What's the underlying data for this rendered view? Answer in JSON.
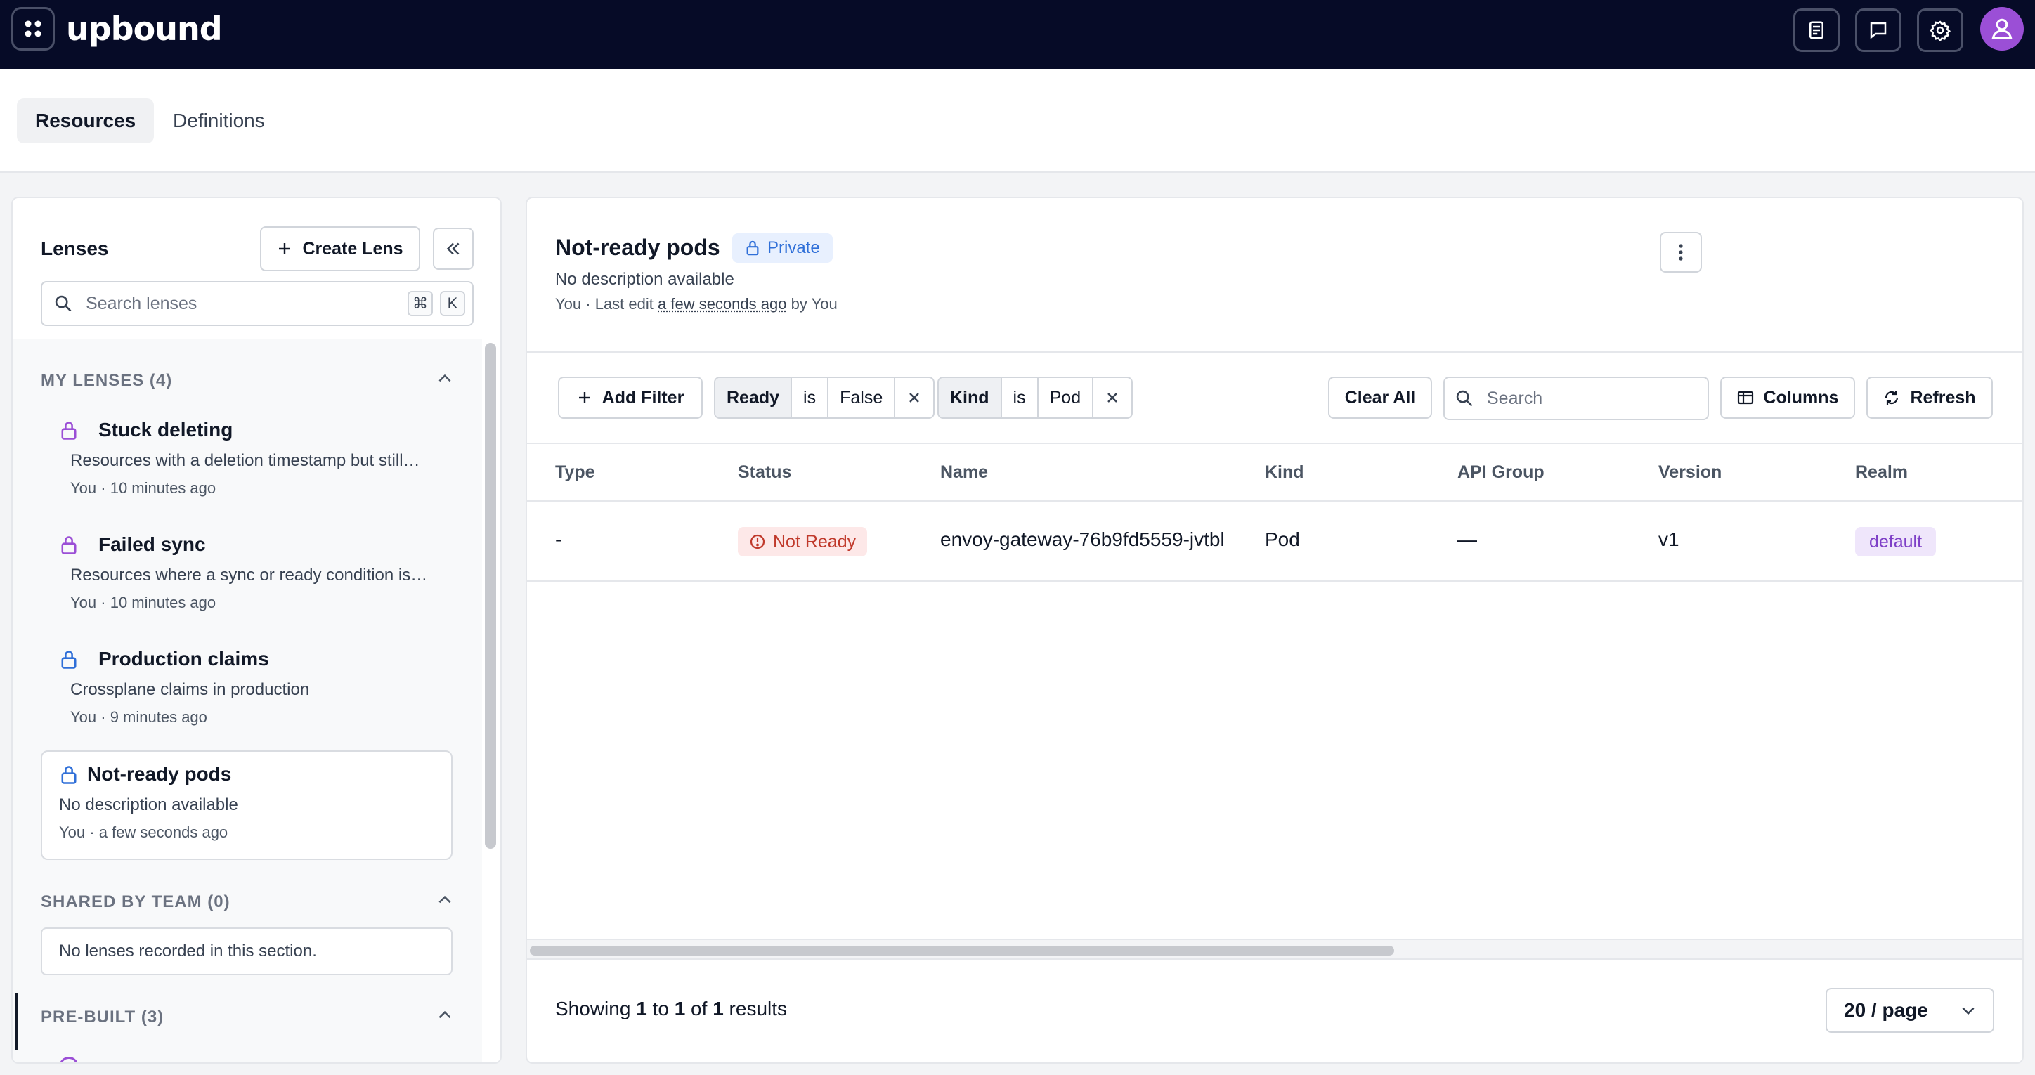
{
  "app": {
    "brand": "upbound"
  },
  "tabs": [
    {
      "label": "Resources"
    },
    {
      "label": "Definitions"
    }
  ],
  "lenses_panel": {
    "title": "Lenses",
    "create_label": "Create Lens",
    "search_placeholder": "Search lenses",
    "shortcut_keys": [
      "⌘",
      "K"
    ],
    "sections": [
      {
        "heading": "MY LENSES (4)",
        "items": [
          {
            "name": "Stuck deleting",
            "description": "Resources with a deletion timestamp but still…",
            "author": "You",
            "time": "10 minutes ago",
            "lock_color": "#9b4fd6"
          },
          {
            "name": "Failed sync",
            "description": "Resources where a sync or ready condition is…",
            "author": "You",
            "time": "10 minutes ago",
            "lock_color": "#9b4fd6"
          },
          {
            "name": "Production claims",
            "description": "Crossplane claims in production",
            "author": "You",
            "time": "9 minutes ago",
            "lock_color": "#2f6fd8"
          },
          {
            "name": "Not-ready pods",
            "description": "No description available",
            "author": "You",
            "time": "a few seconds ago",
            "lock_color": "#2f6fd8"
          }
        ]
      },
      {
        "heading": "SHARED BY TEAM (0)",
        "empty_text": "No lenses recorded in this section."
      },
      {
        "heading": "PRE-BUILT (3)"
      }
    ]
  },
  "lens_detail": {
    "title": "Not-ready pods",
    "visibility": "Private",
    "description": "No description available",
    "meta": {
      "author": "You",
      "last_edit_label": "Last edit",
      "last_edit_time": "a few seconds ago",
      "by_label": "by",
      "editor": "You"
    }
  },
  "toolbar": {
    "add_filter_label": "Add Filter",
    "filters": [
      {
        "key": "Ready",
        "op": "is",
        "value": "False"
      },
      {
        "key": "Kind",
        "op": "is",
        "value": "Pod"
      }
    ],
    "clear_all_label": "Clear All",
    "search_placeholder": "Search",
    "columns_label": "Columns",
    "refresh_label": "Refresh"
  },
  "table": {
    "columns": [
      "Type",
      "Status",
      "Name",
      "Kind",
      "API Group",
      "Version",
      "Realm"
    ],
    "rows": [
      {
        "type": "-",
        "status": "Not Ready",
        "name": "envoy-gateway-76b9fd5559-jvtbl",
        "kind": "Pod",
        "api_group": "—",
        "version": "v1",
        "realm": "default"
      }
    ]
  },
  "pagination": {
    "prefix": "Showing",
    "from": "1",
    "to_label": "to",
    "to": "1",
    "of_label": "of",
    "total": "1",
    "suffix": "results",
    "page_size": "20 / page"
  },
  "colors": {
    "topbar": "#060b27",
    "accent_purple": "#9b4fd6",
    "accent_blue": "#2f6fd8",
    "status_error": "#c0392b"
  }
}
